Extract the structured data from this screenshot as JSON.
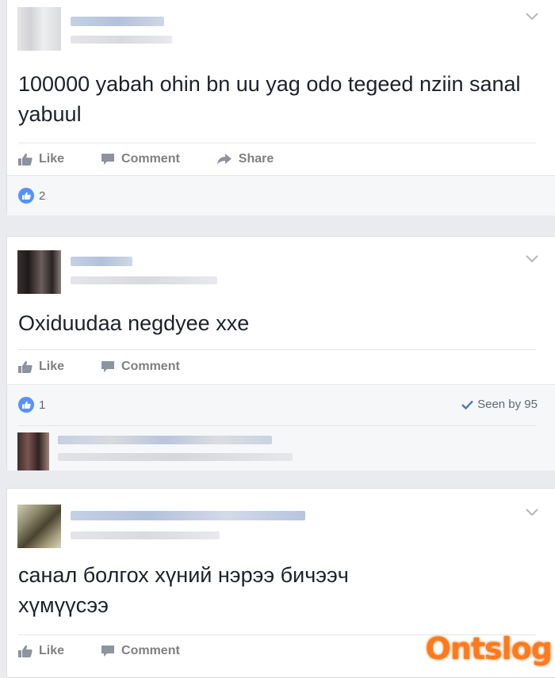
{
  "posts": [
    {
      "text": "100000 yabah ohin bn uu yag odo tegeed nziin sanal yabuul",
      "actions": {
        "like": "Like",
        "comment": "Comment",
        "share": "Share"
      },
      "like_count": "2"
    },
    {
      "text": "Oxiduudaa negdyee xxe",
      "actions": {
        "like": "Like",
        "comment": "Comment"
      },
      "like_count": "1",
      "seen": "Seen by 95"
    },
    {
      "text": "санал болгох хүний нэрээ бичээч хүмүүсээ",
      "actions": {
        "like": "Like",
        "comment": "Comment"
      }
    }
  ],
  "watermark": "Ontslog",
  "colors": {
    "background": "#e9ebee",
    "like_blue": "#5890ff",
    "action_gray": "#7f7f7f",
    "watermark_orange": "#ff7a1a"
  },
  "icons": [
    "chevron-down-icon",
    "thumbs-up-icon",
    "comment-icon",
    "share-icon",
    "checkmark-icon"
  ]
}
